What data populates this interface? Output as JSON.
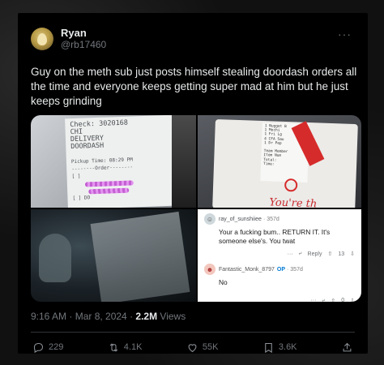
{
  "post": {
    "display_name": "Ryan",
    "handle": "@rb17460",
    "more_icon": "more-icon",
    "text": "Guy on the meth sub just posts himself stealing doordash orders all the time and everyone keeps getting super mad at him but he just keeps grinding",
    "timestamp": "9:16 AM · Mar 8, 2024 · ",
    "views_count": "2.2M",
    "views_label": " Views"
  },
  "media": {
    "receipt_lines": [
      "Check: 3020168",
      "CHI",
      "DELIVERY",
      "DOORDASH",
      "",
      "Pickup Time: 08:29 PM",
      "--------Order--------",
      "[ ]",
      "[ ] DO"
    ],
    "bag_label_lines": [
      "1  Nugget B",
      "1  Mochi",
      "1  Fri Lg",
      "4  CFA Sau",
      "1  Dr Pep",
      "",
      "Team Member",
      "Item Num",
      "Total:",
      "Time:"
    ],
    "bag_brand": "You're th",
    "comments": [
      {
        "user": "ray_of_sunshiiee",
        "time": "· 357d",
        "body": "Your a fucking bum.. RETURN IT. It's someone else's. You twat",
        "reply_label": "Reply",
        "votes": "13"
      },
      {
        "user": "Fantastic_Monk_8797",
        "op_badge": "OP",
        "time": "· 357d",
        "body": "No",
        "votes": "0"
      }
    ]
  },
  "actions": {
    "replies": "229",
    "reposts": "4.1K",
    "likes": "55K",
    "bookmarks": "3.6K"
  },
  "colors": {
    "background": "#000000",
    "text": "#e7e9ea",
    "secondary": "#71767b",
    "divider": "#2f3336",
    "op_blue": "#0079d3"
  }
}
